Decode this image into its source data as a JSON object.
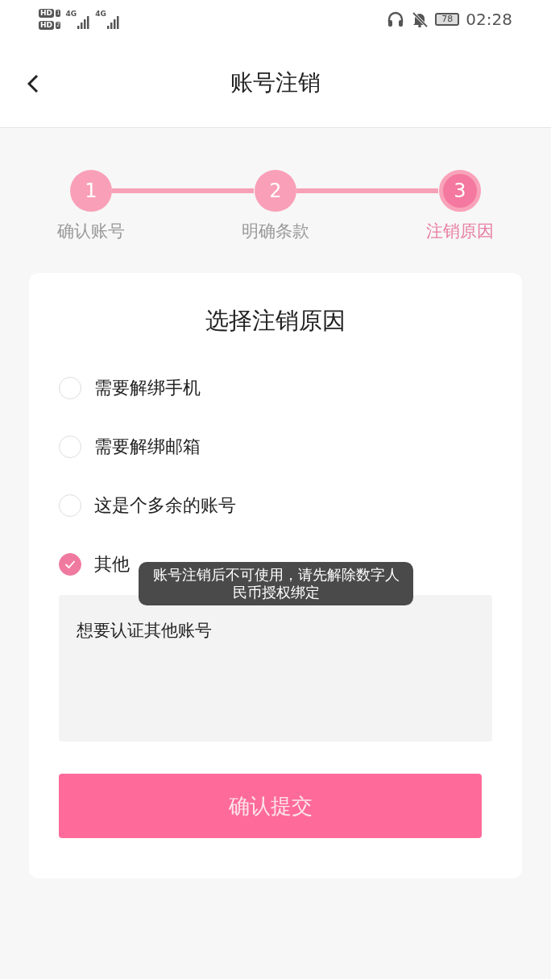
{
  "status_bar": {
    "sims": [
      {
        "badge": "HD",
        "slot": "1",
        "network": "4G"
      },
      {
        "badge": "HD",
        "slot": "2",
        "network": "4G"
      }
    ],
    "battery": "78",
    "time": "02:28"
  },
  "header": {
    "title": "账号注销"
  },
  "steps": [
    {
      "number": "1",
      "label": "确认账号",
      "current": false
    },
    {
      "number": "2",
      "label": "明确条款",
      "current": false
    },
    {
      "number": "3",
      "label": "注销原因",
      "current": true
    }
  ],
  "card": {
    "title": "选择注销原因",
    "reasons": [
      {
        "label": "需要解绑手机",
        "selected": false
      },
      {
        "label": "需要解绑邮箱",
        "selected": false
      },
      {
        "label": "这是个多余的账号",
        "selected": false
      },
      {
        "label": "其他",
        "selected": true
      }
    ],
    "other_reason": {
      "value": "想要认证其他账号"
    },
    "submit": "确认提交"
  },
  "toast": "账号注销后不可使用，请先解除数字人民币授权绑定"
}
